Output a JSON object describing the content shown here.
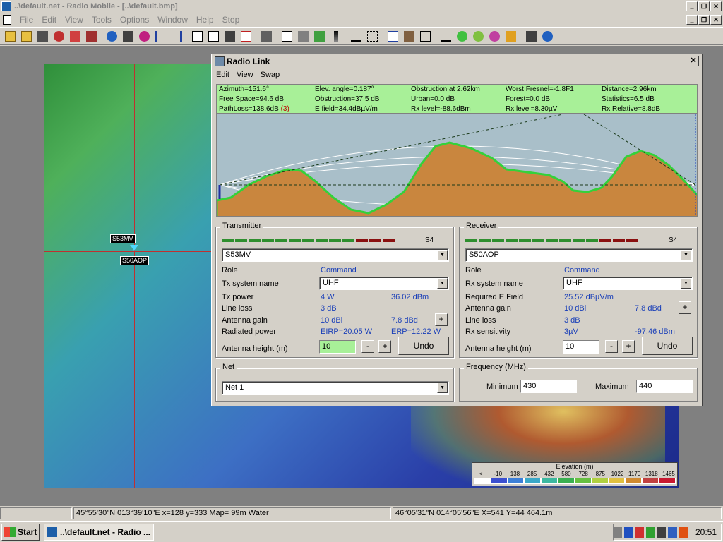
{
  "window": {
    "title": "..\\default.net - Radio Mobile - [..\\default.bmp]"
  },
  "menu": [
    "File",
    "Edit",
    "View",
    "Tools",
    "Options",
    "Window",
    "Help",
    "Stop"
  ],
  "map": {
    "stations": [
      {
        "name": "S53MV"
      },
      {
        "name": "S50AOP"
      }
    ],
    "legend": {
      "title": "Elevation (m)",
      "ticks": [
        "<",
        "-10",
        "138",
        "285",
        "432",
        "580",
        "728",
        "875",
        "1022",
        "1170",
        "1318",
        "1465"
      ],
      "colors": [
        "#ffffff",
        "#3b4fd0",
        "#3c7fd8",
        "#3aa8c8",
        "#3cb8a0",
        "#3ab050",
        "#66c040",
        "#b0d040",
        "#e0c040",
        "#d08a30",
        "#c04040",
        "#c81830"
      ]
    }
  },
  "dialog": {
    "title": "Radio Link",
    "menu": [
      "Edit",
      "View",
      "Swap"
    ],
    "info": {
      "row1": [
        "Azimuth=151.6°",
        "Elev. angle=0.187°",
        "Obstruction at 2.62km",
        "Worst Fresnel=-1.8F1",
        "Distance=2.96km"
      ],
      "row2": [
        "Free Space=94.6 dB",
        "Obstruction=37.5 dB",
        "Urban=0.0 dB",
        "Forest=0.0 dB",
        "Statistics=6.5 dB"
      ],
      "row3_pathloss": "PathLoss=138.6dB",
      "row3_flag": "(3)",
      "row3": [
        "E field=34.4dBµV/m",
        "Rx level=-88.6dBm",
        "Rx level=8.30µV",
        "Rx Relative=8.8dB"
      ]
    },
    "transmitter": {
      "group": "Transmitter",
      "signal": "S4",
      "station": "S53MV",
      "role_label": "Role",
      "role_value": "Command",
      "system_label": "Tx system name",
      "system_value": "UHF",
      "power_label": "Tx power",
      "power_w": "4 W",
      "power_dbm": "36.02 dBm",
      "loss_label": "Line loss",
      "loss_value": "3 dB",
      "gain_label": "Antenna gain",
      "gain_dbi": "10 dBi",
      "gain_dbd": "7.8 dBd",
      "rad_label": "Radiated power",
      "eirp": "EIRP=20.05 W",
      "erp": "ERP=12.22 W",
      "height_label": "Antenna height (m)",
      "height_value": "10",
      "minus": "-",
      "plus": "+",
      "undo": "Undo"
    },
    "receiver": {
      "group": "Receiver",
      "signal": "S4",
      "station": "S50AOP",
      "role_label": "Role",
      "role_value": "Command",
      "system_label": "Rx system name",
      "system_value": "UHF",
      "efield_label": "Required E Field",
      "efield_value": "25.52 dBµV/m",
      "gain_label": "Antenna gain",
      "gain_dbi": "10 dBi",
      "gain_dbd": "7.8 dBd",
      "loss_label": "Line loss",
      "loss_value": "3 dB",
      "sens_label": "Rx sensitivity",
      "sens_uv": "3µV",
      "sens_dbm": "-97.46 dBm",
      "height_label": "Antenna height (m)",
      "height_value": "10",
      "minus": "-",
      "plus": "+",
      "undo": "Undo"
    },
    "net": {
      "group": "Net",
      "value": "Net 1"
    },
    "frequency": {
      "group": "Frequency (MHz)",
      "min_label": "Minimum",
      "min_value": "430",
      "max_label": "Maximum",
      "max_value": "440"
    }
  },
  "status": {
    "left": "",
    "coords": "45°55'30\"N  013°39'10\"E   x=128 y=333 Map= 99m Water",
    "right": "46°05'31\"N 014°05'56\"E  X=541 Y=44 464.1m"
  },
  "taskbar": {
    "start": "Start",
    "task": "..\\default.net - Radio ...",
    "clock": "20:51"
  }
}
